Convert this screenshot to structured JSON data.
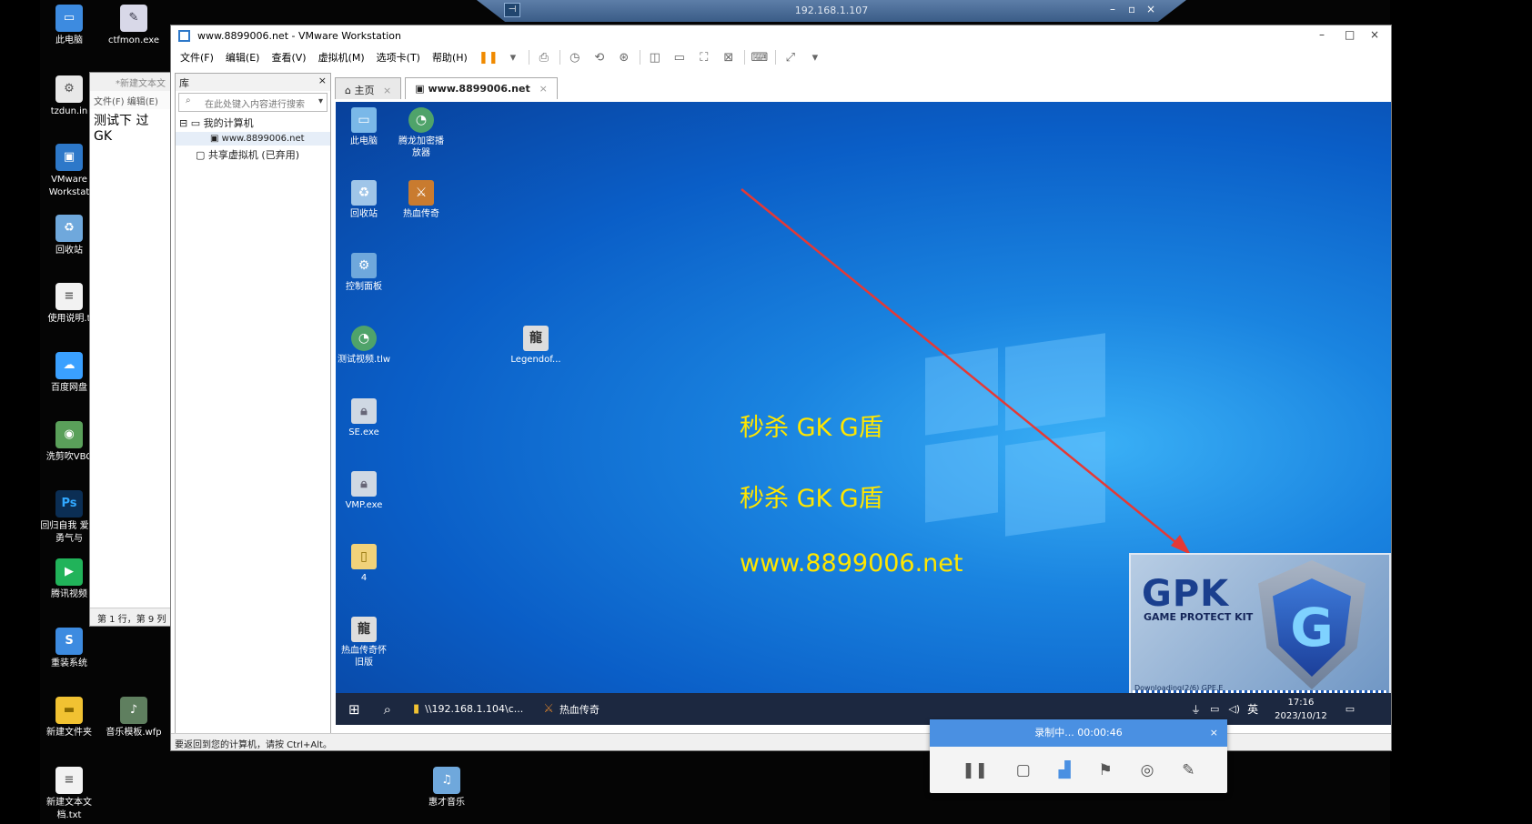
{
  "host_desktop": {
    "icons": [
      {
        "label": "此电脑",
        "icon": "computer-icon",
        "color": "#3d8be0"
      },
      {
        "label": "ctfmon.exe",
        "icon": "notepad-icon",
        "color": "#d8d8e8"
      },
      {
        "label": "tzdun.in",
        "icon": "file-icon",
        "color": "#e8e8e8"
      },
      {
        "label": "VMware Workstat",
        "icon": "vmware-icon",
        "color": "#2d78c9"
      },
      {
        "label": "回收站",
        "icon": "recycle-bin-icon",
        "color": "#6fa8dc"
      },
      {
        "label": "使用说明.t",
        "icon": "text-file-icon",
        "color": "#f2f2f2"
      },
      {
        "label": "百度网盘",
        "icon": "cloud-icon",
        "color": "#3aa0ff"
      },
      {
        "label": "洗剪吹VBC",
        "icon": "eye-icon",
        "color": "#5aa05a"
      },
      {
        "label": "回归自我 爱、勇气与",
        "icon": "photoshop-icon",
        "color": "#0b2e54"
      },
      {
        "label": "腾讯视频",
        "icon": "video-icon",
        "color": "#21b35a"
      },
      {
        "label": "重装系统",
        "icon": "reinstall-icon",
        "color": "#3d8be0"
      },
      {
        "label": "新建文件夹",
        "icon": "folder-icon",
        "color": "#f1c232"
      },
      {
        "label": "音乐模板.wfp",
        "icon": "music-file-icon",
        "color": "#5f7f5f"
      },
      {
        "label": "新建文本文档.txt",
        "icon": "text-file-icon",
        "color": "#f2f2f2"
      },
      {
        "label": "惠才音乐",
        "icon": "music-icon",
        "color": "#6fa8dc"
      }
    ]
  },
  "rdp_bar": {
    "ip": "192.168.1.107",
    "minimize": "–",
    "restore": "▫",
    "close": "×"
  },
  "notepad": {
    "title": "*新建文本文",
    "menu": [
      "文件(F)",
      "编辑(E)"
    ],
    "content": "测试下 过 GK",
    "status": "第 1 行，第 9 列"
  },
  "vmware": {
    "title": "www.8899006.net - VMware Workstation",
    "menu": [
      "文件(F)",
      "编辑(E)",
      "查看(V)",
      "虚拟机(M)",
      "选项卡(T)",
      "帮助(H)"
    ],
    "library": {
      "title": "库",
      "search_placeholder": "在此处键入内容进行搜索",
      "tree": [
        "我的计算机",
        "www.8899006.net",
        "共享虚拟机 (已弃用)"
      ]
    },
    "tabs": [
      {
        "label": "主页"
      },
      {
        "label": "www.8899006.net"
      }
    ],
    "statusbar": "要返回到您的计算机，请按 Ctrl+Alt。"
  },
  "guest": {
    "icons": [
      {
        "label": "此电脑",
        "color": "#7ab8e8"
      },
      {
        "label": "腾龙加密播放器",
        "color": "#4fa36a"
      },
      {
        "label": "回收站",
        "color": "#9fc5e8"
      },
      {
        "label": "热血传奇",
        "color": "#c97b2f"
      },
      {
        "label": "控制面板",
        "color": "#6fa8dc"
      },
      {
        "label": "测试视频.tlw",
        "color": "#4fa36a"
      },
      {
        "label": "Legendof...",
        "color": "#ddd"
      },
      {
        "label": "SE.exe",
        "color": "#cfd8e3"
      },
      {
        "label": "VMP.exe",
        "color": "#cfd8e3"
      },
      {
        "label": "4",
        "color": "#f1d27a"
      },
      {
        "label": "热血传奇怀旧版",
        "color": "#ddd"
      }
    ],
    "overlay": [
      "秒杀 GK G盾",
      "秒杀 GK G盾",
      "www.8899006.net"
    ],
    "gpk": {
      "logo": "GPK",
      "tagline": "GAME PROTECT KIT",
      "downloading": "Downloading(2/6) GPE.E",
      "shield_letter": "G"
    },
    "taskbar": {
      "path": "\\\\192.168.1.104\\c...",
      "app": "热血传奇",
      "ime": "英",
      "time": "17:16",
      "date": "2023/10/12"
    }
  },
  "recorder": {
    "title": "录制中... 00:00:46"
  }
}
